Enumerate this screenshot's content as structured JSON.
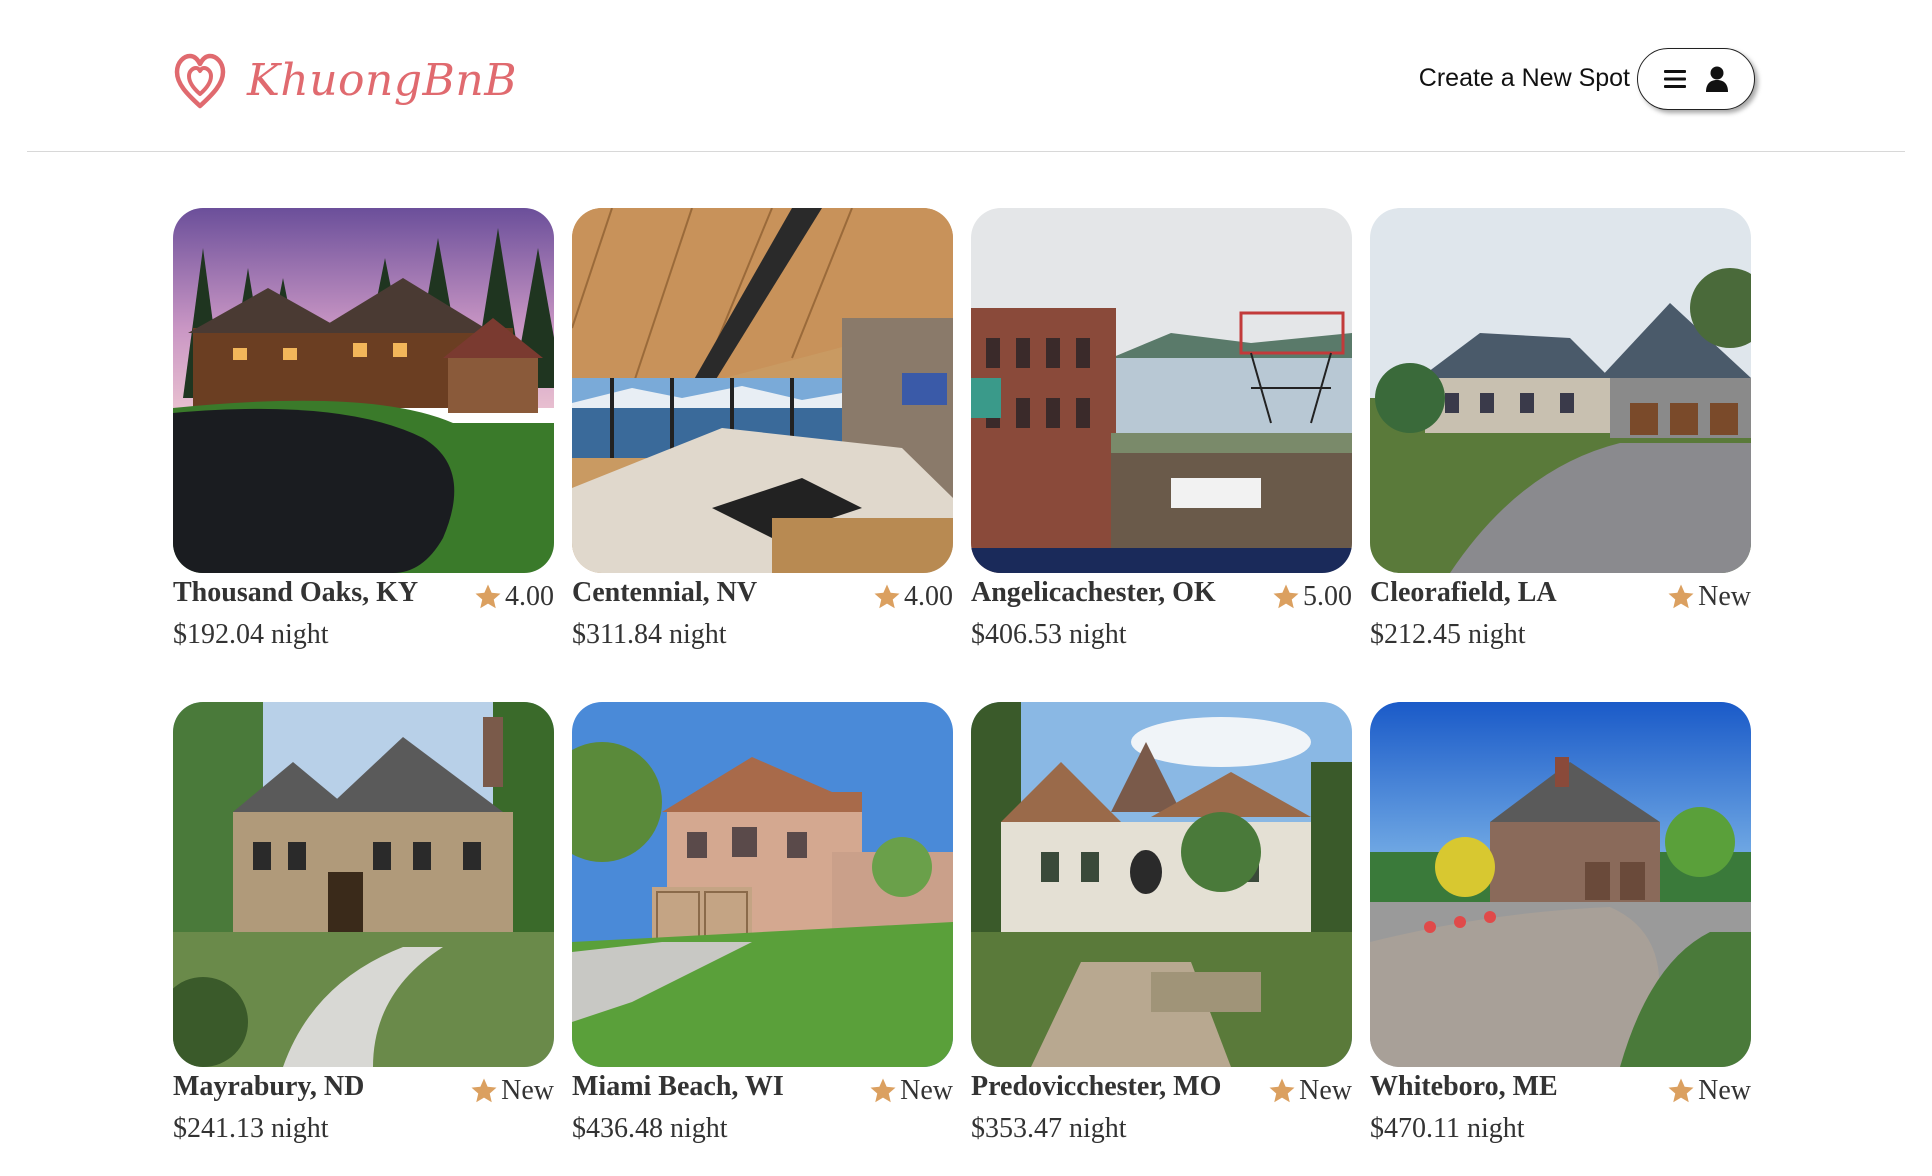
{
  "brand": {
    "name": "KhuongBnB",
    "color": "#e06a6f"
  },
  "header": {
    "create_spot_label": "Create a New Spot",
    "menu_icon": "hamburger-icon",
    "user_icon": "user-icon"
  },
  "colors": {
    "star": "#dba060",
    "text": "#333333"
  },
  "spots": [
    {
      "location": "Thousand Oaks, KY",
      "rating": "4.00",
      "price": "$192.04 night",
      "scene": "log-cabin-dusk"
    },
    {
      "location": "Centennial, NV",
      "rating": "4.00",
      "price": "$311.84 night",
      "scene": "lakeview-kitchen"
    },
    {
      "location": "Angelicachester, OK",
      "rating": "5.00",
      "price": "$406.53 night",
      "scene": "public-market"
    },
    {
      "location": "Cleorafield, LA",
      "rating": "New",
      "price": "$212.45 night",
      "scene": "grey-estate"
    },
    {
      "location": "Mayrabury, ND",
      "rating": "New",
      "price": "$241.13 night",
      "scene": "stone-manor"
    },
    {
      "location": "Miami Beach, WI",
      "rating": "New",
      "price": "$436.48 night",
      "scene": "stucco-house"
    },
    {
      "location": "Predovicchester, MO",
      "rating": "New",
      "price": "$353.47 night",
      "scene": "white-chateau"
    },
    {
      "location": "Whiteboro, ME",
      "rating": "New",
      "price": "$470.11 night",
      "scene": "brick-mansion"
    }
  ]
}
